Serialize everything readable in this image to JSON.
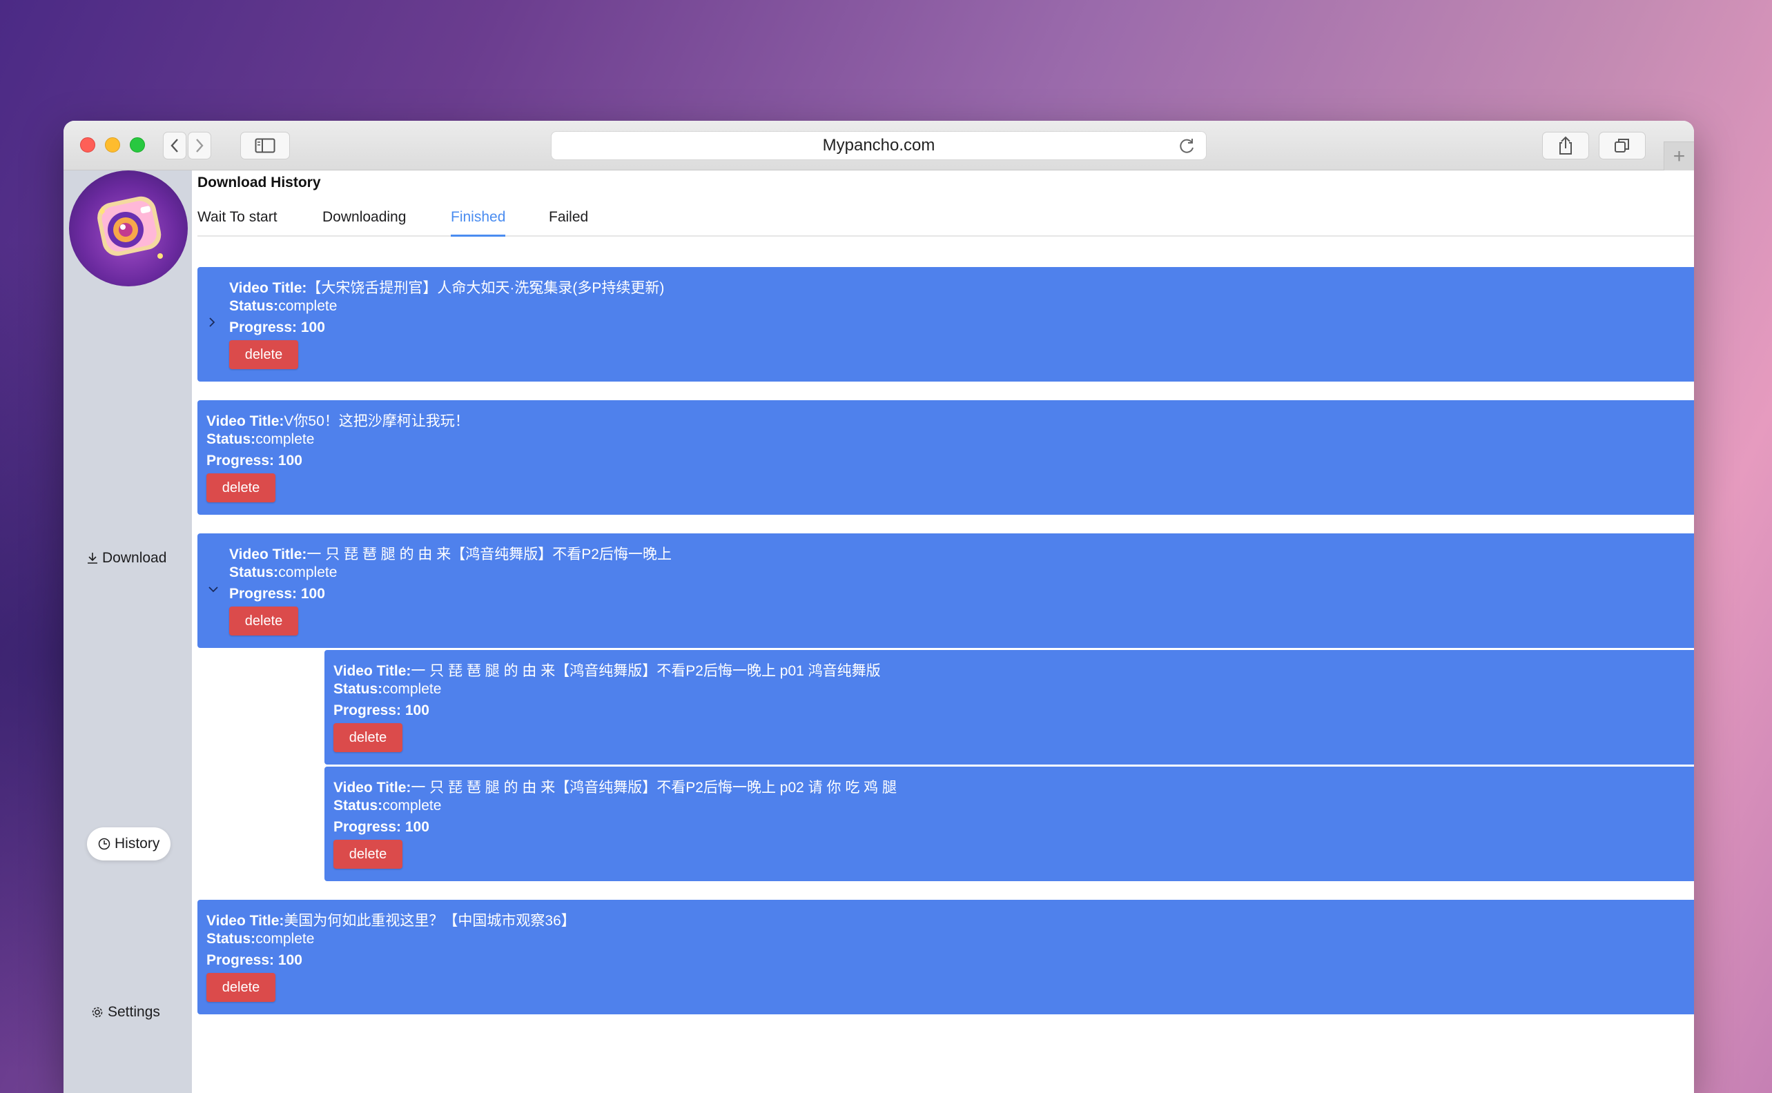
{
  "browser": {
    "url": "Mypancho.com"
  },
  "sidebar": {
    "items": [
      {
        "label": "Download",
        "icon": "download-icon"
      },
      {
        "label": "History",
        "icon": "clock-icon",
        "active": true
      },
      {
        "label": "Settings",
        "icon": "gear-icon"
      }
    ]
  },
  "page": {
    "title": "Download History",
    "tabs": [
      {
        "label": "Wait To start"
      },
      {
        "label": "Downloading"
      },
      {
        "label": "Finished",
        "active": true
      },
      {
        "label": "Failed"
      }
    ]
  },
  "labels": {
    "video_title": "Video Title:",
    "status": "Status:",
    "progress": "Progress: 100",
    "delete": "delete"
  },
  "records": [
    {
      "title": "【大宋饶舌提刑官】人命大如天·洗冤集录(多P持续更新)",
      "status": "complete",
      "progress": 100,
      "collapsible": true,
      "expanded": false
    },
    {
      "title": "V你50！这把沙摩柯让我玩！",
      "status": "complete",
      "progress": 100
    },
    {
      "title": "一 只 琵 琶 腿 的 由 来【鸿音纯舞版】不看P2后悔一晚上",
      "status": "complete",
      "progress": 100,
      "collapsible": true,
      "expanded": true,
      "children": [
        {
          "title": "一 只 琵 琶 腿 的 由 来【鸿音纯舞版】不看P2后悔一晚上 p01 鸿音纯舞版",
          "status": "complete",
          "progress": 100
        },
        {
          "title": "一 只 琵 琶 腿 的 由 来【鸿音纯舞版】不看P2后悔一晚上 p02 请 你 吃 鸡 腿",
          "status": "complete",
          "progress": 100
        }
      ]
    },
    {
      "title": "美国为何如此重视这里？【中国城市观察36】",
      "status": "complete",
      "progress": 100
    }
  ],
  "colors": {
    "card": "#4f81ec",
    "delete": "#db4b4b",
    "tab_active": "#4a8cf0"
  }
}
